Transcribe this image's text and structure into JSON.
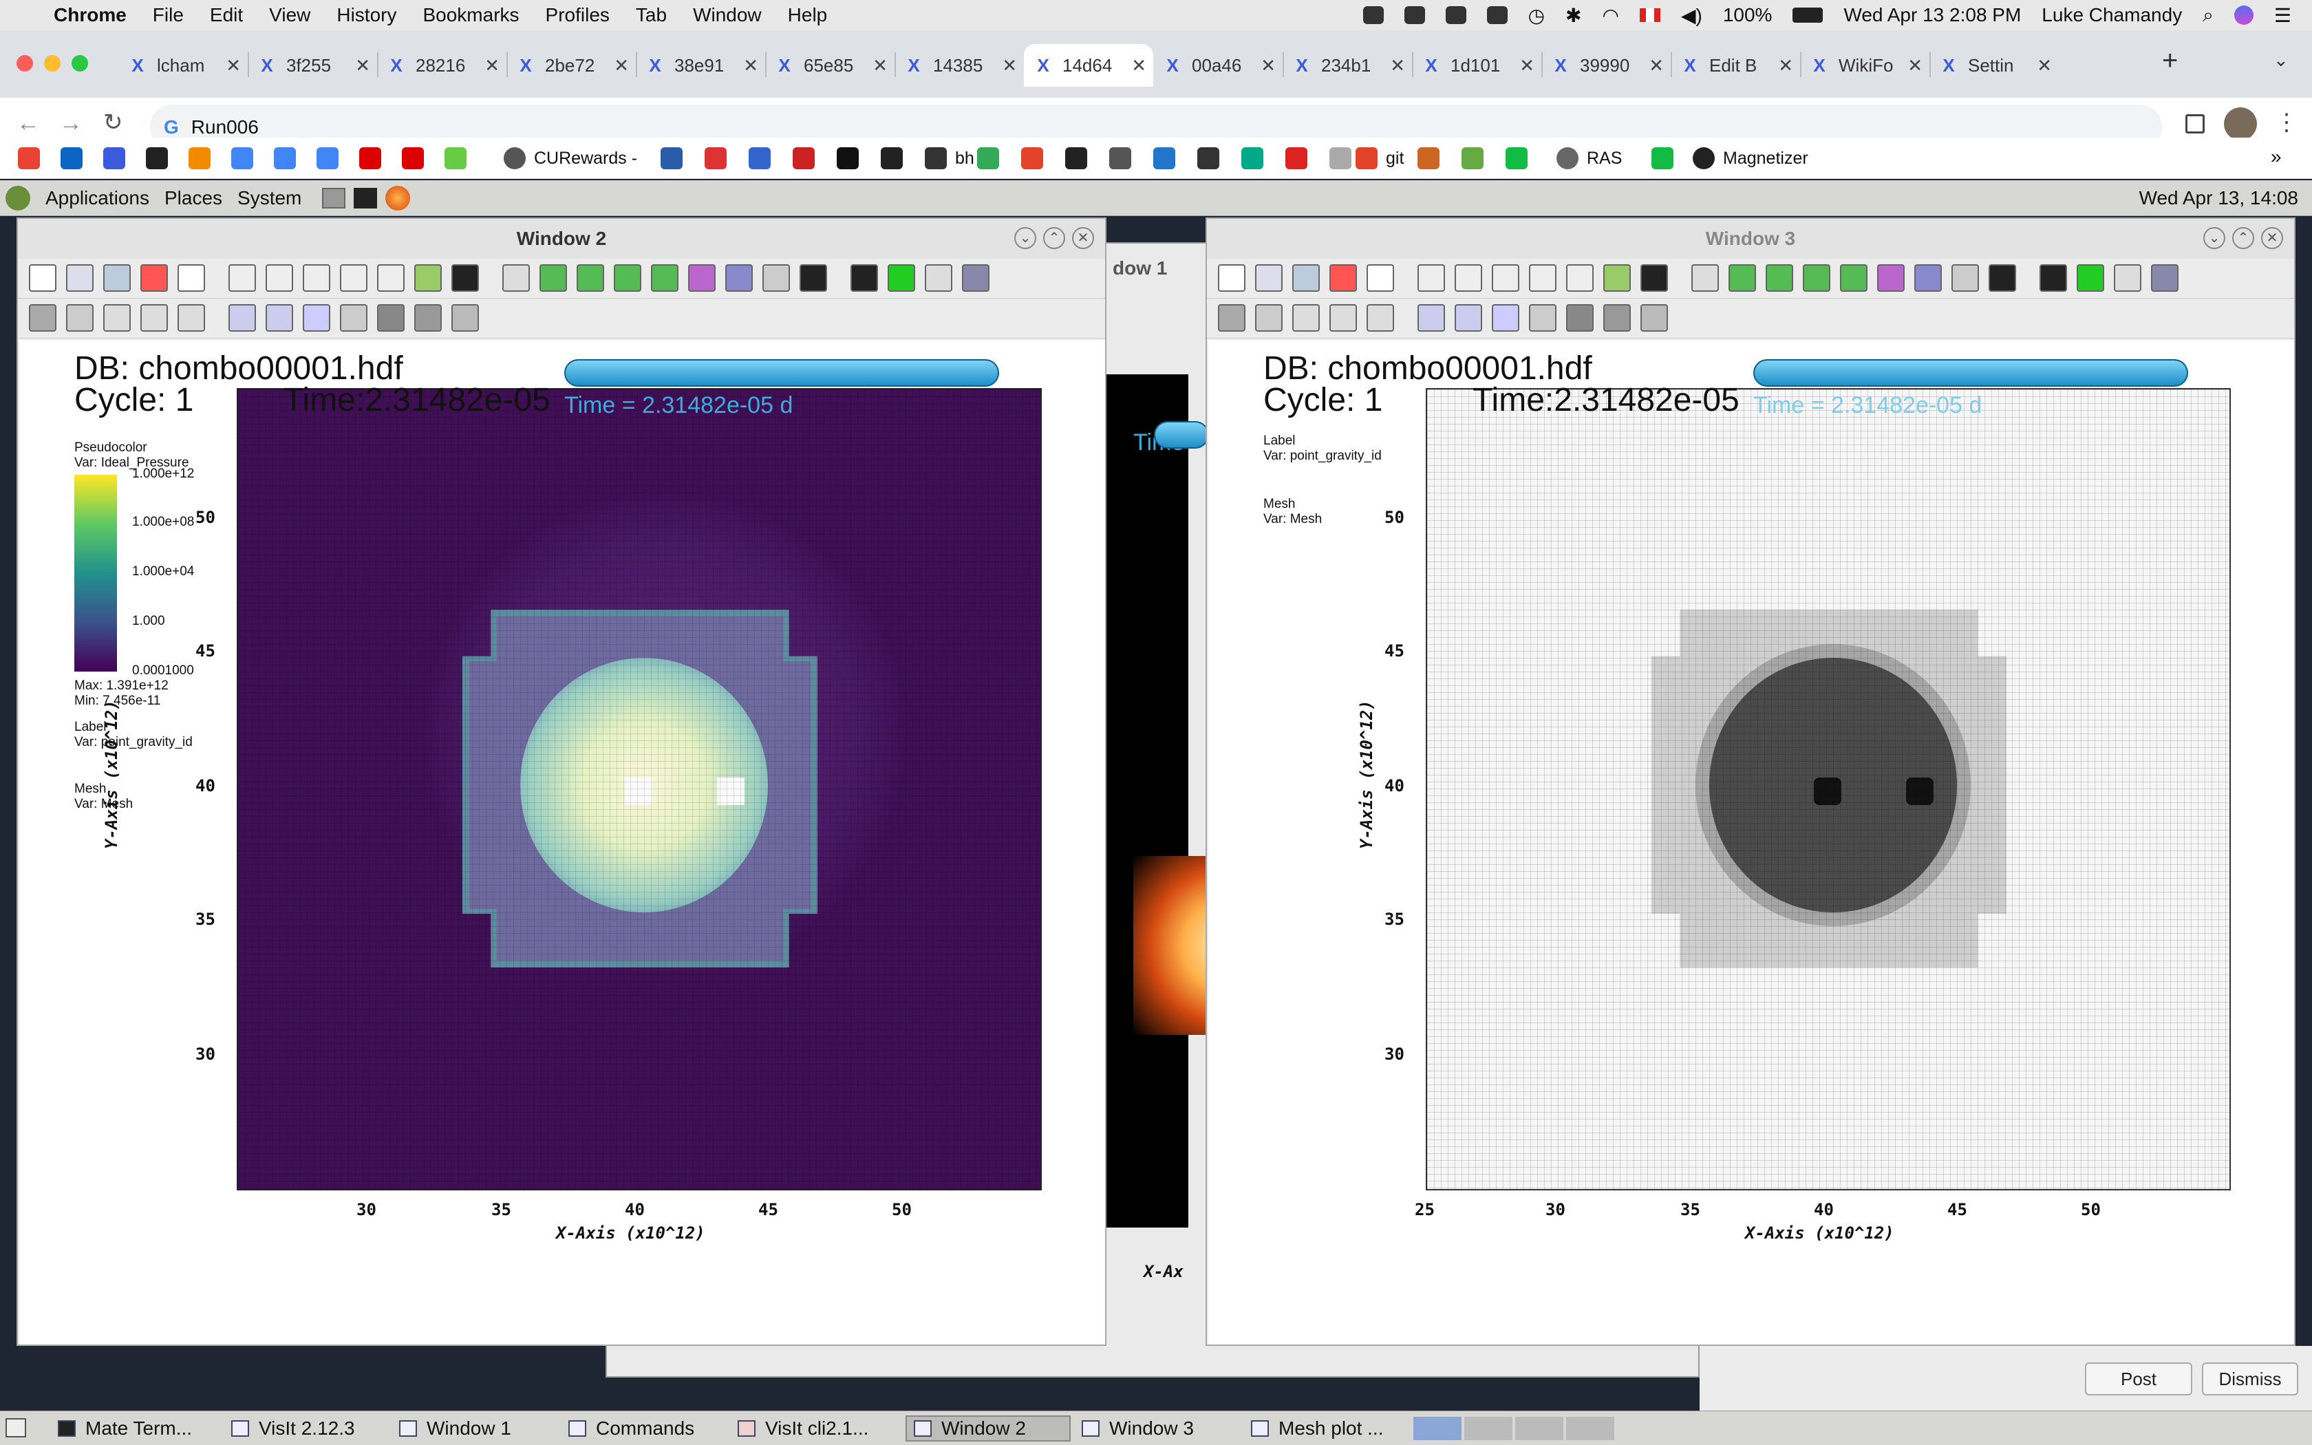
{
  "menubar": {
    "app": "Chrome",
    "items": [
      "File",
      "Edit",
      "View",
      "History",
      "Bookmarks",
      "Profiles",
      "Tab",
      "Window",
      "Help"
    ],
    "battery": "100%",
    "datetime": "Wed Apr 13  2:08 PM",
    "user": "Luke Chamandy"
  },
  "tabs": [
    {
      "label": "lcham",
      "active": false
    },
    {
      "label": "3f255",
      "active": false
    },
    {
      "label": "28216",
      "active": false
    },
    {
      "label": "2be72",
      "active": false
    },
    {
      "label": "38e91",
      "active": false
    },
    {
      "label": "65e85",
      "active": false
    },
    {
      "label": "14385",
      "active": false
    },
    {
      "label": "14d64",
      "active": true
    },
    {
      "label": "00a46",
      "active": false
    },
    {
      "label": "234b1",
      "active": false
    },
    {
      "label": "1d101",
      "active": false
    },
    {
      "label": "39990",
      "active": false
    },
    {
      "label": "Edit B",
      "active": false
    },
    {
      "label": "WikiFo",
      "active": false
    },
    {
      "label": "Settin",
      "active": false
    }
  ],
  "address": "Run006",
  "bookmarks": [
    {
      "label": "CURewards -",
      "color": "#555"
    },
    {
      "label": "bh",
      "color": "#333"
    },
    {
      "label": "git",
      "color": "#e24329"
    },
    {
      "label": "RAS",
      "color": "#666"
    },
    {
      "label": "Magnetizer",
      "color": "#222"
    }
  ],
  "gnome": {
    "items": [
      "Applications",
      "Places",
      "System"
    ],
    "clock": "Wed Apr 13, 14:08"
  },
  "window2": {
    "title": "Window 2",
    "db": "DB: chombo00001.hdf",
    "cycle": "Cycle: 1",
    "time": "Time:2.31482e-05",
    "time_annot": "Time = 2.31482e-05 d",
    "legend": {
      "plot": "Pseudocolor",
      "var": "Var: Ideal_Pressure",
      "ticks": [
        "1.000e+12",
        "1.000e+08",
        "1.000e+04",
        "1.000",
        "0.0001000"
      ],
      "max": "Max:  1.391e+12",
      "min": "Min:  7.456e-11",
      "label_plot": "Label",
      "label_var": "Var: point_gravity_id",
      "mesh_plot": "Mesh",
      "mesh_var": "Var: Mesh"
    },
    "xticks": [
      "30",
      "35",
      "40",
      "45",
      "50"
    ],
    "yticks": [
      "50",
      "45",
      "40",
      "35",
      "30"
    ],
    "xlabel": "X-Axis  (x10^12)",
    "ylabel": "Y-Axis  (x10^12)"
  },
  "window1": {
    "title": "dow 1",
    "time": "Time",
    "xlabel": "X-Ax"
  },
  "window3": {
    "title": "Window 3",
    "db": "DB: chombo00001.hdf",
    "cycle": "Cycle: 1",
    "time": "Time:2.31482e-05",
    "time_annot": "Time = 2.31482e-05 d",
    "legend": {
      "label_plot": "Label",
      "label_var": "Var: point_gravity_id",
      "mesh_plot": "Mesh",
      "mesh_var": "Var: Mesh"
    },
    "xticks": [
      "25",
      "30",
      "35",
      "40",
      "45",
      "50"
    ],
    "yticks": [
      "50",
      "45",
      "40",
      "35",
      "30"
    ],
    "xlabel": "X-Axis  (x10^12)",
    "ylabel": "Y-Axis  (x10^12)"
  },
  "dialog": {
    "post": "Post",
    "dismiss": "Dismiss"
  },
  "taskbar": [
    "Mate Term...",
    "VisIt 2.12.3",
    "Window 1",
    "Commands",
    "VisIt cli2.1...",
    "Window 2",
    "Window 3",
    "Mesh plot ..."
  ]
}
